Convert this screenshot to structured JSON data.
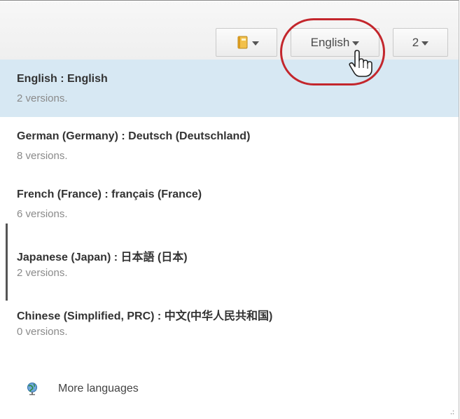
{
  "toolbar": {
    "book_icon": "book-icon",
    "language_button_label": "English",
    "version_button_label": "2"
  },
  "languages": [
    {
      "title": "English : English",
      "versions": "2 versions.",
      "selected": true
    },
    {
      "title": "German (Germany) : Deutsch (Deutschland)",
      "versions": "8 versions.",
      "selected": false
    },
    {
      "title": "French (France) : français (France)",
      "versions": "6 versions.",
      "selected": false
    },
    {
      "title": "Japanese (Japan) : 日本語 (日本)",
      "versions": "2 versions.",
      "selected": false
    },
    {
      "title": "Chinese (Simplified, PRC) : 中文(中华人民共和国)",
      "versions": "0 versions.",
      "selected": false
    }
  ],
  "more_languages": {
    "icon": "globe-icon",
    "label": "More languages"
  },
  "colors": {
    "selected_row": "#d7e8f3",
    "highlight_ring": "#c3262c"
  }
}
